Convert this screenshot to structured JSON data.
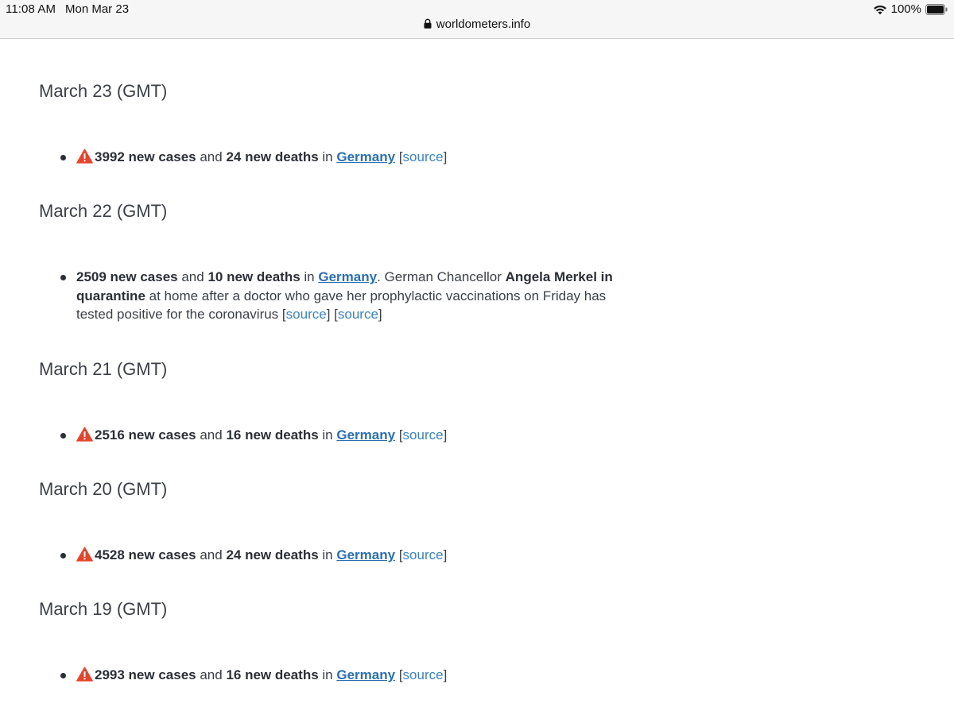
{
  "status_bar": {
    "time": "11:08 AM",
    "date": "Mon Mar 23",
    "battery_percent": "100%",
    "icons": [
      "wifi-icon",
      "battery-icon"
    ]
  },
  "browser": {
    "url": "worldometers.info",
    "icon": "lock-icon"
  },
  "colors": {
    "link": "#2a6fb4",
    "warning": "#e8442b",
    "text": "#2b2f36"
  },
  "days": [
    {
      "title": "March 23 (GMT)",
      "warning": true,
      "cases": "3992 new cases",
      "and": "and",
      "deaths": "24 new deaths",
      "in": "in",
      "country": "Germany",
      "source": "source"
    },
    {
      "title": "March 22 (GMT)",
      "warning": false,
      "cases": "2509 new cases",
      "and": "and",
      "deaths": "10 new deaths",
      "in": "in",
      "country": "Germany",
      "text1": ". German Chancellor",
      "bold2": "Angela Merkel in quarantine",
      "text2": "at home after a doctor who gave her prophylactic vaccinations on Friday has tested positive for the coronavirus",
      "source": "source",
      "source2": "source"
    },
    {
      "title": "March 21 (GMT)",
      "warning": true,
      "cases": "2516 new cases",
      "and": "and",
      "deaths": "16 new deaths",
      "in": "in",
      "country": "Germany",
      "source": "source"
    },
    {
      "title": "March 20 (GMT)",
      "warning": true,
      "cases": "4528 new cases",
      "and": "and",
      "deaths": "24 new deaths",
      "in": "in",
      "country": "Germany",
      "source": "source"
    },
    {
      "title": "March 19 (GMT)",
      "warning": true,
      "cases": "2993 new cases",
      "and": "and",
      "deaths": "16 new deaths",
      "in": "in",
      "country": "Germany",
      "source": "source"
    }
  ]
}
